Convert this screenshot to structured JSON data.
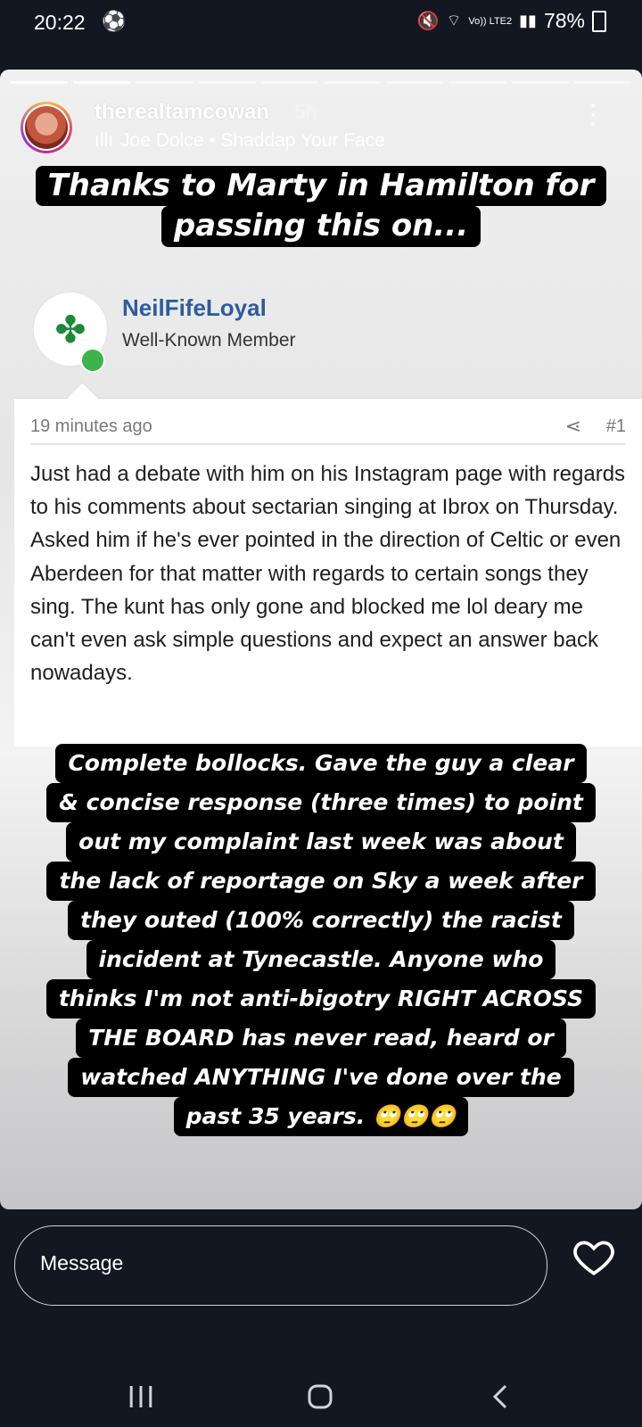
{
  "status_bar": {
    "time": "20:22",
    "battery": "78%",
    "network": "Vo)) LTE2"
  },
  "story": {
    "username": "therealtamcowan",
    "time_ago": "5h",
    "music": "Joe Dolce • Shaddap Your Face",
    "sticker_top": [
      "Thanks to Marty in Hamilton for",
      "passing this on..."
    ],
    "sticker_bottom": [
      "Complete bollocks. Gave the guy a clear",
      "& concise response (three times) to point",
      "out my complaint last week was about",
      "the lack of reportage on Sky a week after",
      "they outed (100% correctly) the racist",
      "incident at Tynecastle. Anyone who",
      "thinks I'm not anti-bigotry RIGHT ACROSS",
      "THE BOARD has never read, heard or",
      "watched ANYTHING I've done over the",
      "past 35 years. 🙄🙄🙄"
    ]
  },
  "forum_post": {
    "author": "NeilFifeLoyal",
    "role": "Well-Known Member",
    "posted": "19 minutes ago",
    "post_number": "#1",
    "body": "Just had a debate with him on his Instagram page with regards to his comments about sectarian singing at Ibrox on Thursday. Asked him if he's ever pointed in the direction of Celtic or even Aberdeen for that matter with regards to certain songs they sing. The kunt has only gone and blocked me lol deary me can't even ask simple questions and expect an answer back nowadays."
  },
  "reply": {
    "placeholder": "Message"
  }
}
